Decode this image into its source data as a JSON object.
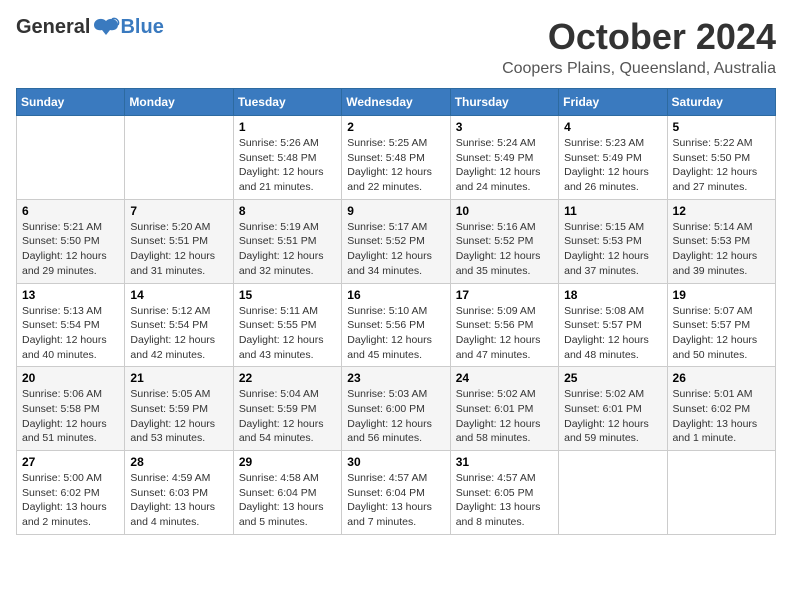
{
  "header": {
    "logo_general": "General",
    "logo_blue": "Blue",
    "month": "October 2024",
    "location": "Coopers Plains, Queensland, Australia"
  },
  "weekdays": [
    "Sunday",
    "Monday",
    "Tuesday",
    "Wednesday",
    "Thursday",
    "Friday",
    "Saturday"
  ],
  "weeks": [
    [
      {
        "day": "",
        "info": ""
      },
      {
        "day": "",
        "info": ""
      },
      {
        "day": "1",
        "info": "Sunrise: 5:26 AM\nSunset: 5:48 PM\nDaylight: 12 hours and 21 minutes."
      },
      {
        "day": "2",
        "info": "Sunrise: 5:25 AM\nSunset: 5:48 PM\nDaylight: 12 hours and 22 minutes."
      },
      {
        "day": "3",
        "info": "Sunrise: 5:24 AM\nSunset: 5:49 PM\nDaylight: 12 hours and 24 minutes."
      },
      {
        "day": "4",
        "info": "Sunrise: 5:23 AM\nSunset: 5:49 PM\nDaylight: 12 hours and 26 minutes."
      },
      {
        "day": "5",
        "info": "Sunrise: 5:22 AM\nSunset: 5:50 PM\nDaylight: 12 hours and 27 minutes."
      }
    ],
    [
      {
        "day": "6",
        "info": "Sunrise: 5:21 AM\nSunset: 5:50 PM\nDaylight: 12 hours and 29 minutes."
      },
      {
        "day": "7",
        "info": "Sunrise: 5:20 AM\nSunset: 5:51 PM\nDaylight: 12 hours and 31 minutes."
      },
      {
        "day": "8",
        "info": "Sunrise: 5:19 AM\nSunset: 5:51 PM\nDaylight: 12 hours and 32 minutes."
      },
      {
        "day": "9",
        "info": "Sunrise: 5:17 AM\nSunset: 5:52 PM\nDaylight: 12 hours and 34 minutes."
      },
      {
        "day": "10",
        "info": "Sunrise: 5:16 AM\nSunset: 5:52 PM\nDaylight: 12 hours and 35 minutes."
      },
      {
        "day": "11",
        "info": "Sunrise: 5:15 AM\nSunset: 5:53 PM\nDaylight: 12 hours and 37 minutes."
      },
      {
        "day": "12",
        "info": "Sunrise: 5:14 AM\nSunset: 5:53 PM\nDaylight: 12 hours and 39 minutes."
      }
    ],
    [
      {
        "day": "13",
        "info": "Sunrise: 5:13 AM\nSunset: 5:54 PM\nDaylight: 12 hours and 40 minutes."
      },
      {
        "day": "14",
        "info": "Sunrise: 5:12 AM\nSunset: 5:54 PM\nDaylight: 12 hours and 42 minutes."
      },
      {
        "day": "15",
        "info": "Sunrise: 5:11 AM\nSunset: 5:55 PM\nDaylight: 12 hours and 43 minutes."
      },
      {
        "day": "16",
        "info": "Sunrise: 5:10 AM\nSunset: 5:56 PM\nDaylight: 12 hours and 45 minutes."
      },
      {
        "day": "17",
        "info": "Sunrise: 5:09 AM\nSunset: 5:56 PM\nDaylight: 12 hours and 47 minutes."
      },
      {
        "day": "18",
        "info": "Sunrise: 5:08 AM\nSunset: 5:57 PM\nDaylight: 12 hours and 48 minutes."
      },
      {
        "day": "19",
        "info": "Sunrise: 5:07 AM\nSunset: 5:57 PM\nDaylight: 12 hours and 50 minutes."
      }
    ],
    [
      {
        "day": "20",
        "info": "Sunrise: 5:06 AM\nSunset: 5:58 PM\nDaylight: 12 hours and 51 minutes."
      },
      {
        "day": "21",
        "info": "Sunrise: 5:05 AM\nSunset: 5:59 PM\nDaylight: 12 hours and 53 minutes."
      },
      {
        "day": "22",
        "info": "Sunrise: 5:04 AM\nSunset: 5:59 PM\nDaylight: 12 hours and 54 minutes."
      },
      {
        "day": "23",
        "info": "Sunrise: 5:03 AM\nSunset: 6:00 PM\nDaylight: 12 hours and 56 minutes."
      },
      {
        "day": "24",
        "info": "Sunrise: 5:02 AM\nSunset: 6:01 PM\nDaylight: 12 hours and 58 minutes."
      },
      {
        "day": "25",
        "info": "Sunrise: 5:02 AM\nSunset: 6:01 PM\nDaylight: 12 hours and 59 minutes."
      },
      {
        "day": "26",
        "info": "Sunrise: 5:01 AM\nSunset: 6:02 PM\nDaylight: 13 hours and 1 minute."
      }
    ],
    [
      {
        "day": "27",
        "info": "Sunrise: 5:00 AM\nSunset: 6:02 PM\nDaylight: 13 hours and 2 minutes."
      },
      {
        "day": "28",
        "info": "Sunrise: 4:59 AM\nSunset: 6:03 PM\nDaylight: 13 hours and 4 minutes."
      },
      {
        "day": "29",
        "info": "Sunrise: 4:58 AM\nSunset: 6:04 PM\nDaylight: 13 hours and 5 minutes."
      },
      {
        "day": "30",
        "info": "Sunrise: 4:57 AM\nSunset: 6:04 PM\nDaylight: 13 hours and 7 minutes."
      },
      {
        "day": "31",
        "info": "Sunrise: 4:57 AM\nSunset: 6:05 PM\nDaylight: 13 hours and 8 minutes."
      },
      {
        "day": "",
        "info": ""
      },
      {
        "day": "",
        "info": ""
      }
    ]
  ]
}
